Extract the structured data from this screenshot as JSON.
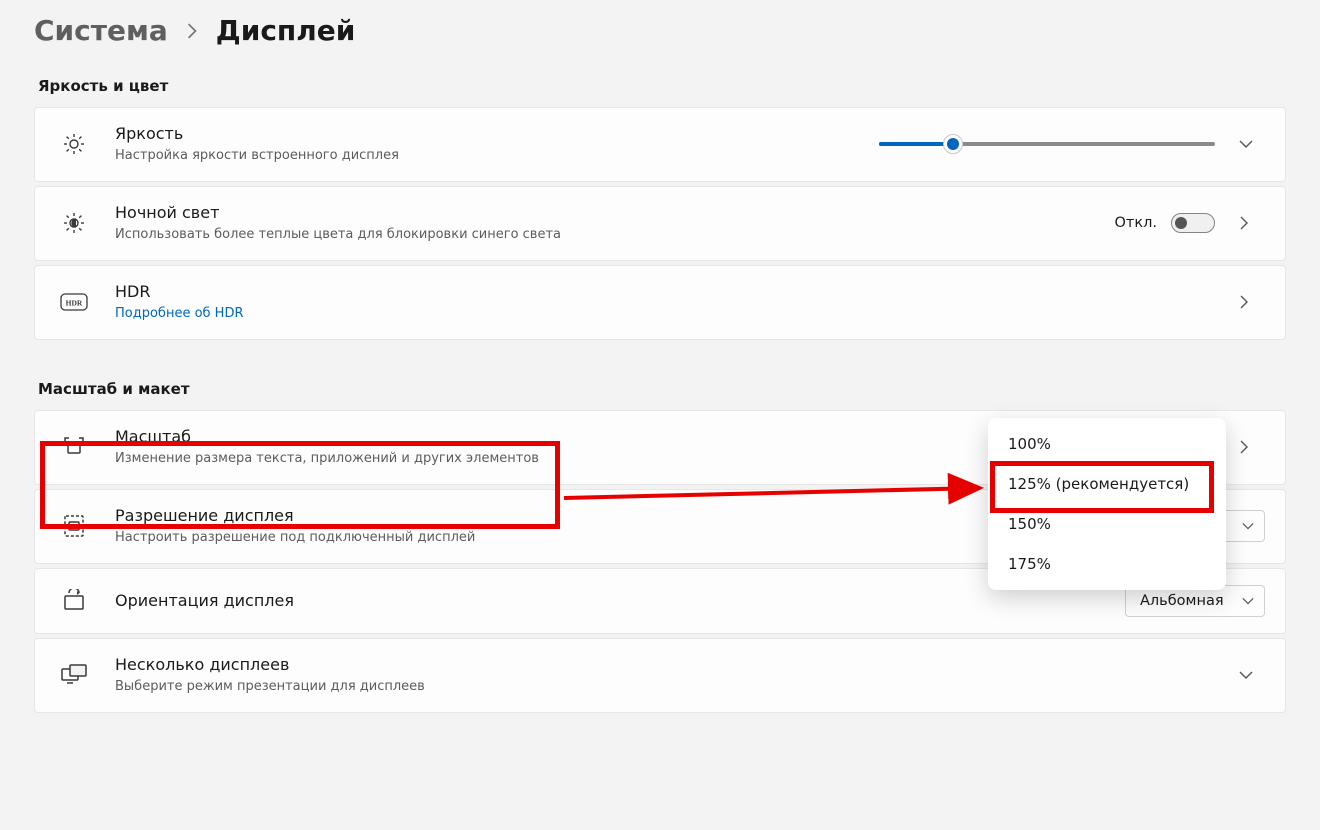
{
  "breadcrumb": {
    "parent": "Система",
    "current": "Дисплей"
  },
  "sections": {
    "brightness_color": "Яркость и цвет",
    "scale_layout": "Масштаб и макет"
  },
  "brightness": {
    "title": "Яркость",
    "sub": "Настройка яркости встроенного дисплея"
  },
  "nightlight": {
    "title": "Ночной свет",
    "sub": "Использовать более теплые цвета для блокировки синего света",
    "state_label": "Откл."
  },
  "hdr": {
    "title": "HDR",
    "sub": "Подробнее об HDR"
  },
  "scale": {
    "title": "Масштаб",
    "sub": "Изменение размера текста, приложений и других элементов",
    "options": [
      "100%",
      "125% (рекомендуется)",
      "150%",
      "175%"
    ],
    "selected_index": 1
  },
  "resolution": {
    "title": "Разрешение дисплея",
    "sub": "Настроить разрешение под подключенный дисплей"
  },
  "orientation": {
    "title": "Ориентация дисплея",
    "value": "Альбомная"
  },
  "multi": {
    "title": "Несколько дисплеев",
    "sub": "Выберите режим презентации для дисплеев"
  }
}
